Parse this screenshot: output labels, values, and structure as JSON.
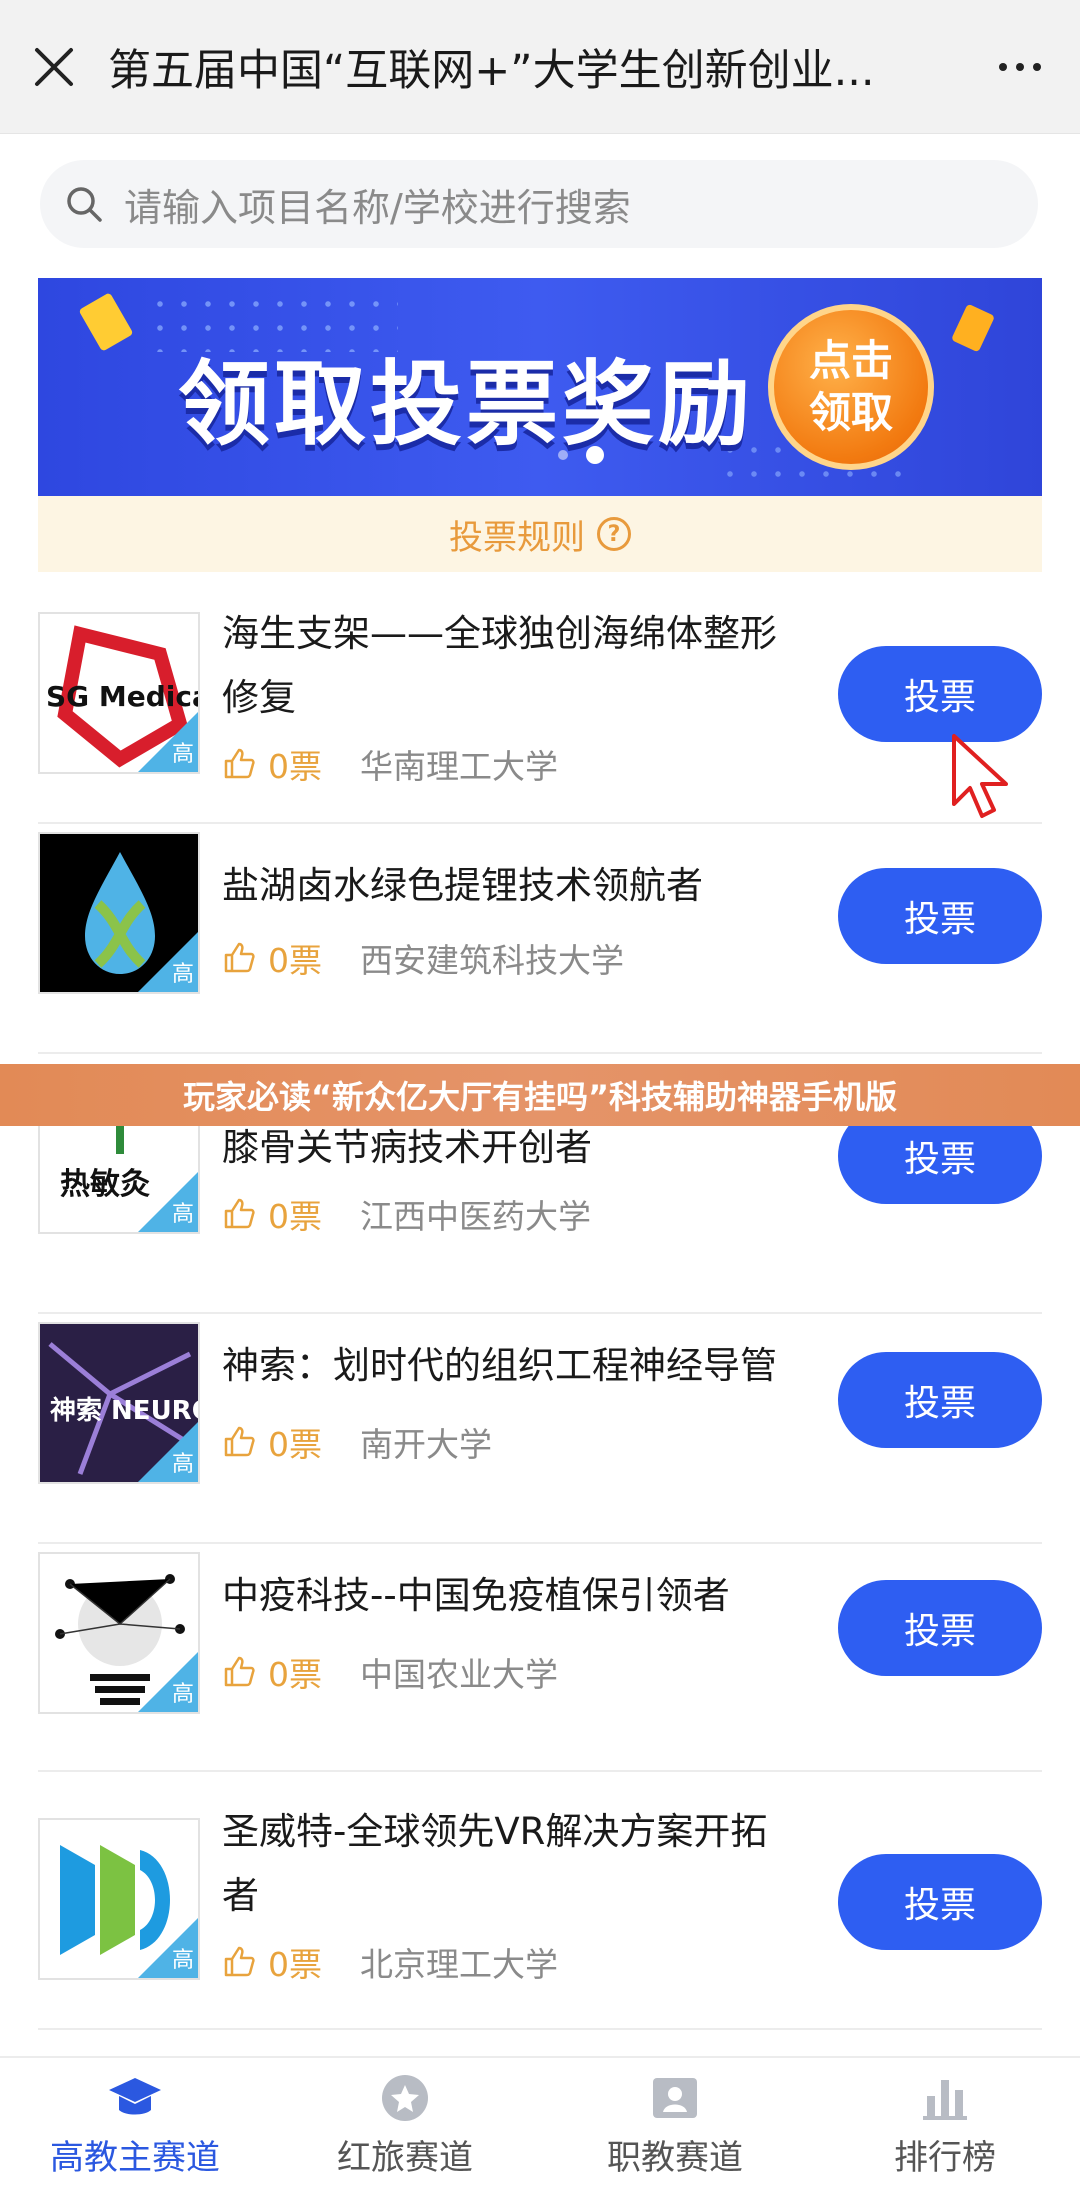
{
  "header": {
    "title": "第五届中国“互联网+”大学生创新创业..."
  },
  "search": {
    "placeholder": "请输入项目名称/学校进行搜索"
  },
  "banner": {
    "text": "领取投票奖励",
    "badge_line1": "点击",
    "badge_line2": "领取"
  },
  "rules": {
    "label": "投票规则",
    "help_symbol": "?"
  },
  "tag_label": "高",
  "vote_button_label": "投票",
  "projects": [
    {
      "title": "海生支架——全球独创海绵体整形修复",
      "votes": "0票",
      "school": "华南理工大学",
      "thumb_text": "SG Medical"
    },
    {
      "title": "盐湖卤水绿色提锂技术领航者",
      "votes": "0票",
      "school": "西安建筑科技大学",
      "thumb_text": ""
    },
    {
      "title": "Godlike膝动力—全球热敏灸治疗膝骨关节病技术开创者",
      "votes": "0票",
      "school": "江西中医药大学",
      "thumb_text": "热敏灸"
    },
    {
      "title": "神索：划时代的组织工程神经导管",
      "votes": "0票",
      "school": "南开大学",
      "thumb_text": "神索 NEUROPE"
    },
    {
      "title": "中疫科技--中国免疫植保引领者",
      "votes": "0票",
      "school": "中国农业大学",
      "thumb_text": ""
    },
    {
      "title": "圣威特-全球领先VR解决方案开拓者",
      "votes": "0票",
      "school": "北京理工大学",
      "thumb_text": ""
    }
  ],
  "overlay": {
    "text": "玩家必读“新众亿大厅有挂吗”科技辅助神器手机版"
  },
  "tabs": [
    {
      "label": "高教主赛道",
      "icon": "graduation-cap-icon",
      "active": true
    },
    {
      "label": "红旅赛道",
      "icon": "star-icon",
      "active": false
    },
    {
      "label": "职教赛道",
      "icon": "id-card-icon",
      "active": false
    },
    {
      "label": "排行榜",
      "icon": "bar-chart-icon",
      "active": false
    }
  ],
  "colors": {
    "primary": "#2e5ef2",
    "vote_count": "#e8a33d",
    "rules": "#e89a3c",
    "overlay": "#e28a56"
  }
}
